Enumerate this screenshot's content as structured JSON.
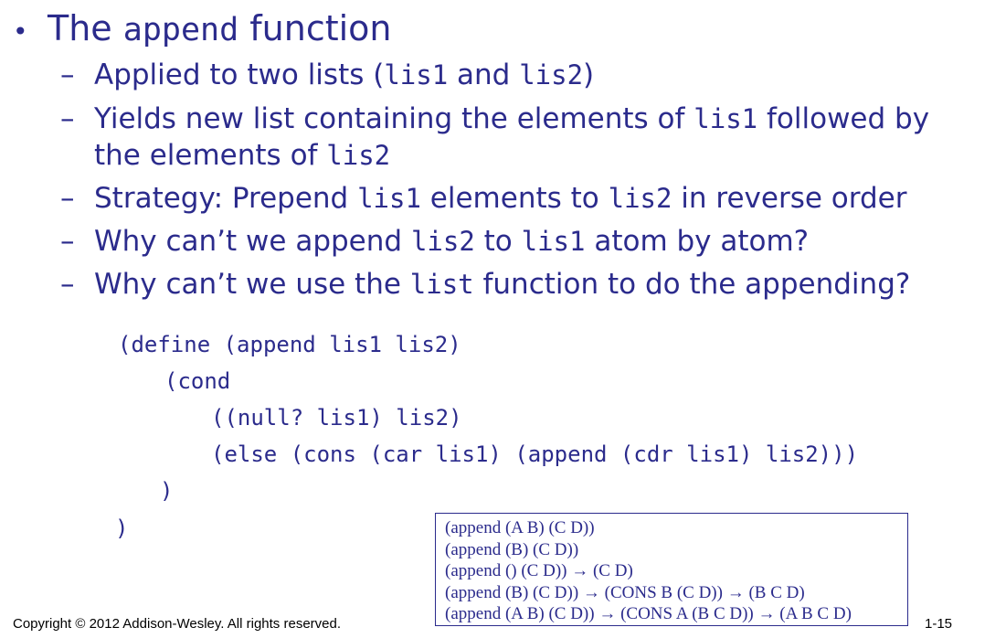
{
  "title": {
    "text_before": "The ",
    "code": "append",
    "text_after": " function"
  },
  "bullets": [
    {
      "parts": [
        {
          "t": "Applied to two lists ("
        },
        {
          "c": "lis1"
        },
        {
          "t": " and "
        },
        {
          "c": "lis2"
        },
        {
          "t": ")"
        }
      ]
    },
    {
      "parts": [
        {
          "t": "Yields new list containing the elements of "
        },
        {
          "c": "lis1"
        },
        {
          "t": " followed by"
        }
      ],
      "parts2": [
        {
          "t": "the elements of "
        },
        {
          "c": "lis2"
        }
      ]
    },
    {
      "parts": [
        {
          "t": "Strategy: Prepend "
        },
        {
          "c": "lis1"
        },
        {
          "t": " elements to "
        },
        {
          "c": "lis2"
        },
        {
          "t": " in reverse order"
        }
      ]
    },
    {
      "parts": [
        {
          "t": "Why can’t we append "
        },
        {
          "c": "lis2"
        },
        {
          "t": " to "
        },
        {
          "c": "lis1"
        },
        {
          "t": " atom by atom?"
        }
      ]
    },
    {
      "parts": [
        {
          "t": "Why can’t we use the "
        },
        {
          "c": "list"
        },
        {
          "t": " function to do the appending?"
        }
      ]
    }
  ],
  "code_lines": [
    "(define (append lis1 lis2)",
    "(cond",
    "((null? lis1) lis2)",
    "(else (cons (car lis1) (append (cdr lis1) lis2)))",
    ")",
    ")"
  ],
  "examples": [
    "(append (A B) (C D))",
    "(append (B) (C D))",
    "(append () (C D)) → (C D)",
    "(append (B) (C D)) → (CONS B (C D)) → (B C D)",
    "(append (A B) (C D)) → (CONS A (B C D)) → (A B C D)"
  ],
  "footer": {
    "copyright": "Copyright © 2012 Addison-Wesley. All rights reserved.",
    "slide_number": "1-15"
  }
}
